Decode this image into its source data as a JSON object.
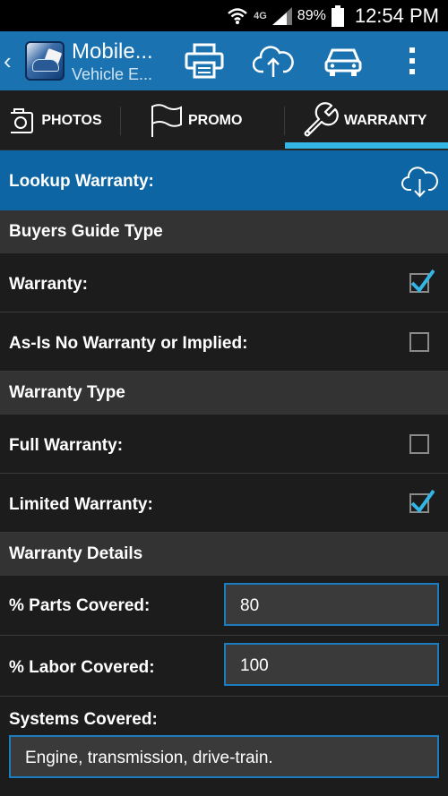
{
  "status_bar": {
    "network": "4G",
    "battery": "89%",
    "time": "12:54 PM"
  },
  "action_bar": {
    "title": "Mobile...",
    "subtitle": "Vehicle E...",
    "icons": [
      "print-icon",
      "cloud-upload-icon",
      "car-icon",
      "overflow-menu-icon"
    ]
  },
  "tabs": [
    {
      "label": "PHOTOS",
      "icon": "camera-icon"
    },
    {
      "label": "PROMO",
      "icon": "flag-icon"
    },
    {
      "label": "WARRANTY",
      "icon": "wrench-icon",
      "selected": true
    }
  ],
  "lookup": {
    "label": "Lookup Warranty:",
    "icon": "cloud-download-icon"
  },
  "sections": {
    "buyers_guide": "Buyers Guide Type",
    "warranty_type": "Warranty Type",
    "warranty_details": "Warranty Details"
  },
  "buyers_guide_rows": [
    {
      "label": "Warranty:",
      "checked": true
    },
    {
      "label": "As-Is No Warranty or Implied:",
      "checked": false
    }
  ],
  "warranty_type_rows": [
    {
      "label": "Full Warranty:",
      "checked": false
    },
    {
      "label": "Limited Warranty:",
      "checked": true
    }
  ],
  "details": {
    "parts_label": "% Parts Covered:",
    "parts_value": "80",
    "labor_label": "% Labor Covered:",
    "labor_value": "100",
    "systems_label": "Systems Covered:",
    "systems_value": "Engine, transmission, drive-train."
  },
  "colors": {
    "accent": "#33b5e5",
    "action_bar": "#1a72b0",
    "lookup_bar": "#0d65a3",
    "section_bg": "#333333"
  }
}
